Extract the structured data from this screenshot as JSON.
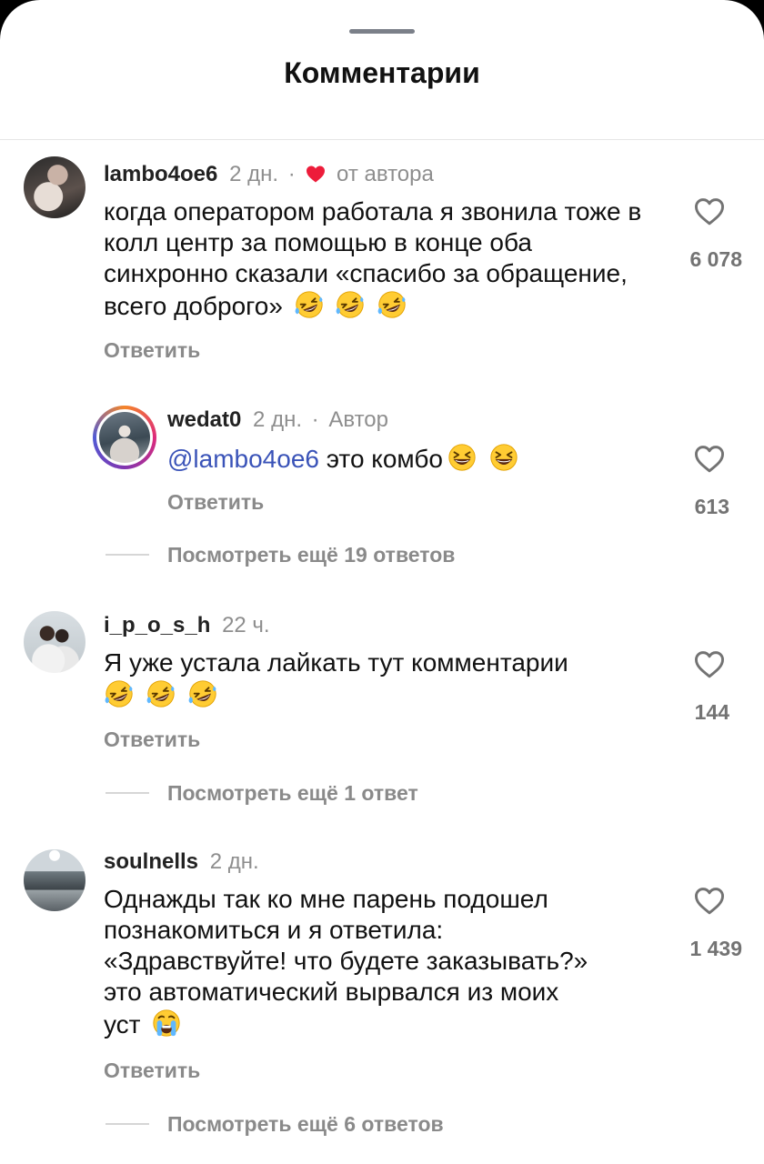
{
  "header": {
    "title": "Комментарии"
  },
  "comments": [
    {
      "username": "lambo4oe6",
      "time": "2 дн.",
      "author_like": "от автора",
      "text": "когда оператором работала я звонила тоже в колл центр за помощью в конце оба синхронно сказали «спасибо за обращение, всего доброго»",
      "emojis": [
        "rofl-emoji",
        "rofl-emoji",
        "rofl-emoji"
      ],
      "reply_label": "Ответить",
      "likes": "6 078",
      "replies": [
        {
          "username": "wedat0",
          "time": "2 дн.",
          "badge": "Автор",
          "mention": "@lambo4oe6",
          "text": " это комбо",
          "reply_label": "Ответить",
          "likes": "613"
        }
      ],
      "more_replies": "Посмотреть ещё 19 ответов"
    },
    {
      "username": "i_p_o_s_h",
      "time": "22 ч.",
      "text": "Я уже устала лайкать тут комментарии",
      "reply_label": "Ответить",
      "likes": "144",
      "more_replies": "Посмотреть ещё 1 ответ"
    },
    {
      "username": "soulnells",
      "time": "2 дн.",
      "text_lines": [
        "Однажды так ко мне парень подошел",
        "познакомиться и я ответила:",
        "«Здравствуйте! что будете заказывать?»",
        "это автоматический вырвался из моих",
        "уст"
      ],
      "reply_label": "Ответить",
      "likes": "1 439",
      "more_replies": "Посмотреть ещё 6 ответов"
    }
  ],
  "dot": "·"
}
